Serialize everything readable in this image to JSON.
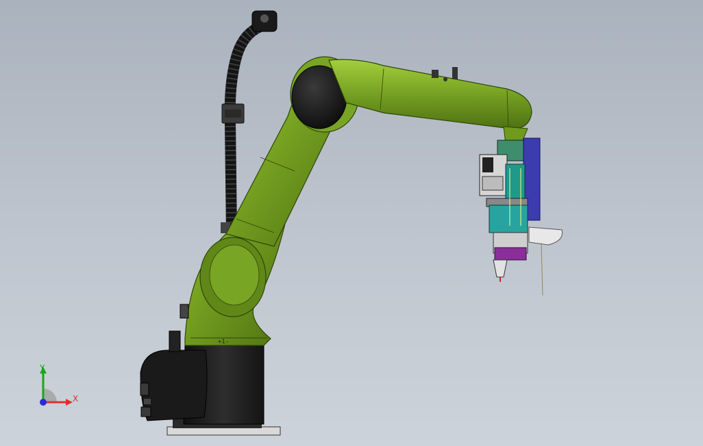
{
  "viewport": {
    "joint_mark": "+1-"
  },
  "triad": {
    "x_label": "X",
    "y_label": "Y",
    "x_color": "#e52b2b",
    "y_color": "#18a818",
    "z_color": "#2a2ad8"
  },
  "colors": {
    "arm_green": "#6e9a1c",
    "arm_green_light": "#8fbd2e",
    "arm_green_dark": "#4a6b10",
    "base_black": "#1b1b1b",
    "tool_teal": "#1f9a8a",
    "tool_blue": "#3c3cae"
  },
  "icons": {
    "triad": "coordinate-triad-icon"
  }
}
